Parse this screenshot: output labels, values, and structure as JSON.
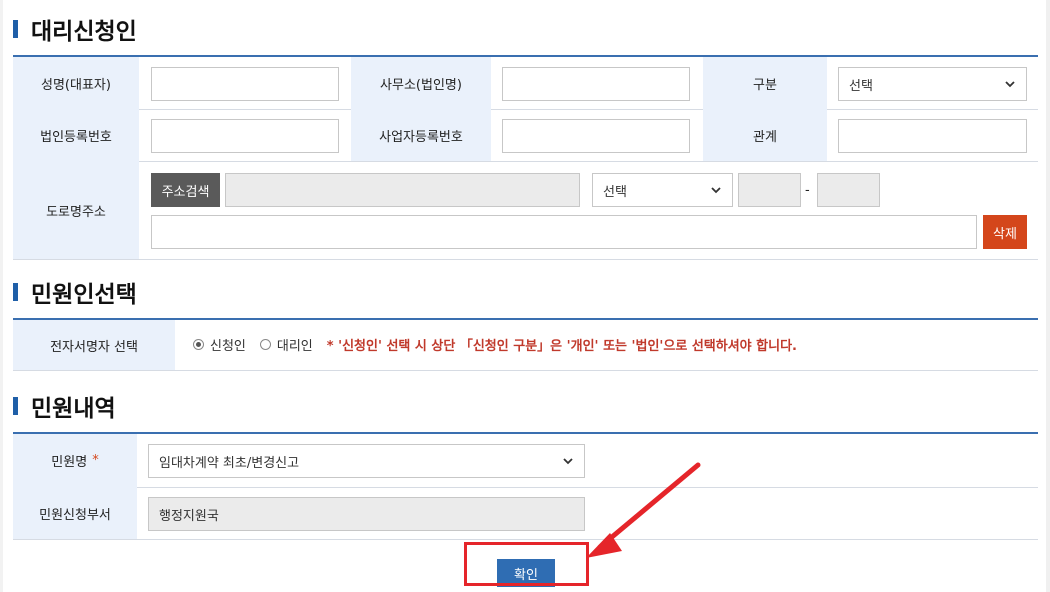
{
  "agent": {
    "title": "대리신청인",
    "name_label": "성명(대표자)",
    "office_label": "사무소(법인명)",
    "type_label": "구분",
    "type_select_value": "선택",
    "corp_no_label": "법인등록번호",
    "biz_no_label": "사업자등록번호",
    "relation_label": "관계",
    "address_label": "도로명주소",
    "address_search_button": "주소검색",
    "phone_select_value": "선택",
    "phone_dash": "-",
    "delete_button": "삭제"
  },
  "applicant_select": {
    "title": "민원인선택",
    "signer_label": "전자서명자 선택",
    "options": [
      "신청인",
      "대리인"
    ],
    "selected": "신청인",
    "note": "* '신청인' 선택 시 상단 「신청인 구분」은 '개인' 또는 '법인'으로 선택하셔야 합니다."
  },
  "civil_details": {
    "title": "민원내역",
    "name_label": "민원명",
    "required_mark": "*",
    "name_select_value": "임대차계약 최초/변경신고",
    "dept_label": "민원신청부서",
    "dept_value": "행정지원국"
  },
  "confirm_button": "확인",
  "colors": {
    "accent": "#1f5fa8",
    "label_bg": "#eaf1fb",
    "delete_red": "#d4461b",
    "highlight_red": "#e5252a",
    "confirm_blue": "#2f6db3"
  }
}
